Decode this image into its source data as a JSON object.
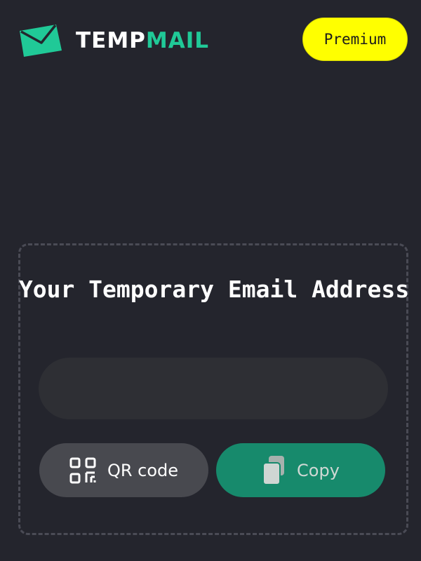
{
  "header": {
    "logo": {
      "text_part1": "TEMP",
      "text_part2": "MAIL",
      "icon": "envelope-icon"
    },
    "premium_label": "Premium"
  },
  "main": {
    "title": "Your Temporary Email Address",
    "email_value": "",
    "qr_button": {
      "label": "QR code",
      "icon": "qr-code-icon"
    },
    "copy_button": {
      "label": "Copy",
      "icon": "copy-icon"
    }
  },
  "colors": {
    "background": "#24252d",
    "brand_green": "#20c997",
    "premium_yellow": "#ffff00",
    "copy_button": "#178a6c",
    "qr_button": "#48494f"
  }
}
